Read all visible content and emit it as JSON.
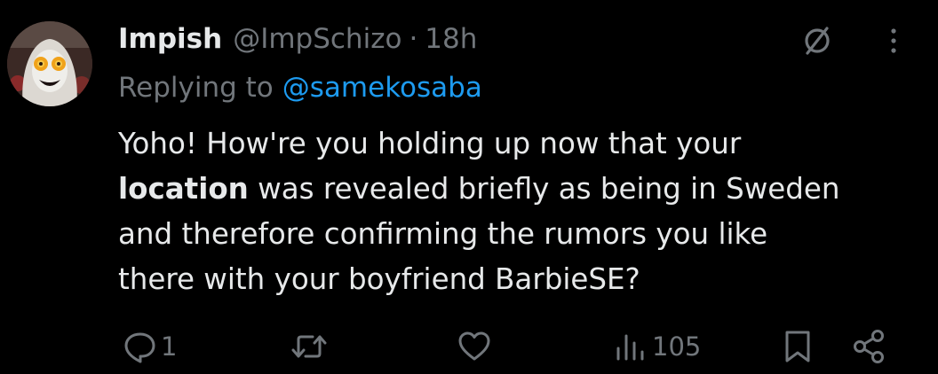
{
  "tweet": {
    "author": {
      "display_name": "Impish",
      "handle": "@ImpSchizo",
      "separator": "·",
      "time": "18h"
    },
    "replying": {
      "prefix": "Replying to",
      "mention": "@samekosaba"
    },
    "body": {
      "line1": "Yoho! How're you holding up now that your",
      "line2_bold": "location",
      "line2_rest": " was revealed briefly as being in Sweden",
      "line3": "and therefore confirming the rumors you like",
      "line4": "there with your boyfriend BarbieSE?"
    },
    "actions": {
      "reply_count": "1",
      "retweet_count": "",
      "like_count": "",
      "view_count": "105"
    },
    "icons": {
      "grok": "slashed-circle-icon",
      "more": "more-vertical-icon",
      "reply": "reply-icon",
      "retweet": "retweet-icon",
      "like": "heart-icon",
      "views": "views-bar-chart-icon",
      "bookmark": "bookmark-icon",
      "share": "share-icon"
    },
    "colors": {
      "background": "#000000",
      "text_primary": "#e7e9ea",
      "text_secondary": "#71767b",
      "accent_blue": "#1d9bf0"
    }
  }
}
